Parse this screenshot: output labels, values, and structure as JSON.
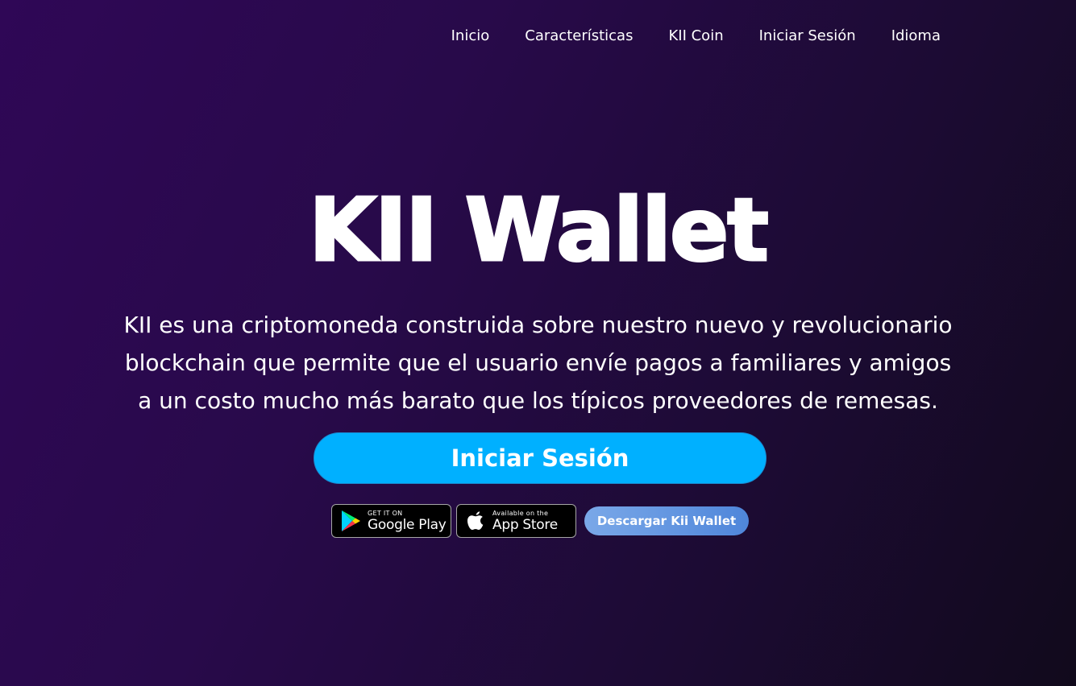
{
  "nav": {
    "items": [
      {
        "label": "Inicio"
      },
      {
        "label": "Características"
      },
      {
        "label": "KII Coin"
      },
      {
        "label": "Iniciar Sesión"
      },
      {
        "label": "Idioma"
      }
    ]
  },
  "hero": {
    "title": "KII Wallet",
    "description": "KII es una criptomoneda construida sobre nuestro nuevo y revolucionario blockchain que permite que el usuario envíe pagos a familiares y amigos a un costo mucho más barato que los típicos proveedores de remesas.",
    "cta_label": "Iniciar Sesión"
  },
  "stores": {
    "google_play": {
      "small": "GET IT ON",
      "big": "Google Play",
      "icon": "google-play-icon"
    },
    "app_store": {
      "small": "Available on the",
      "big": "App Store",
      "icon": "apple-icon"
    },
    "download_label": "Descargar Kii Wallet"
  },
  "colors": {
    "background_start": "#2f0756",
    "background_end": "#110a1c",
    "cta": "#00b0ff",
    "download_start": "#7aa8e8",
    "download_end": "#4f86da"
  }
}
